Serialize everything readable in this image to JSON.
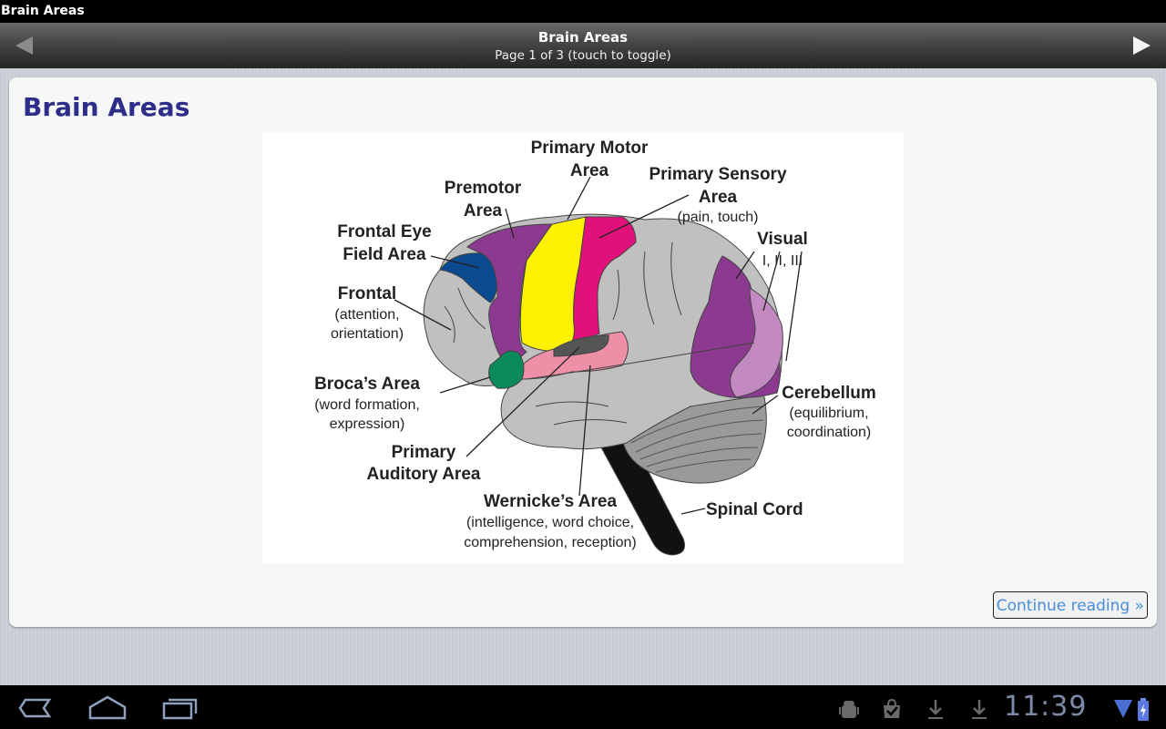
{
  "app": {
    "window_title": "Brain Areas"
  },
  "nav": {
    "title": "Brain Areas",
    "subtitle": "Page 1 of 3 (touch to toggle)",
    "prev_icon": "triangle-left-icon",
    "next_icon": "triangle-right-icon"
  },
  "page": {
    "heading": "Brain Areas",
    "continue_label": "Continue reading »"
  },
  "figure": {
    "labels": {
      "primary_motor_1": "Primary Motor",
      "primary_motor_2": "Area",
      "primary_sensory_1": "Primary Sensory",
      "primary_sensory_2": "Area",
      "primary_sensory_3": "(pain, touch)",
      "premotor_1": "Premotor",
      "premotor_2": "Area",
      "frontal_eye_1": "Frontal Eye",
      "frontal_eye_2": "Field Area",
      "visual_1": "Visual",
      "visual_2": "I, II, III",
      "frontal_1": "Frontal",
      "frontal_2": "(attention,",
      "frontal_3": "orientation)",
      "broca_1": "Broca’s Area",
      "broca_2": "(word formation,",
      "broca_3": "expression)",
      "cerebellum_1": "Cerebellum",
      "cerebellum_2": "(equilibrium,",
      "cerebellum_3": "coordination)",
      "auditory_1": "Primary",
      "auditory_2": "Auditory Area",
      "wernicke_1": "Wernicke’s Area",
      "wernicke_2": "(intelligence, word choice,",
      "wernicke_3": "comprehension, reception)",
      "spinal_1": "Spinal Cord"
    },
    "colors": {
      "cortex": "#c0c0c0",
      "premotor": "#8b3a8f",
      "primary_motor": "#fff200",
      "primary_sensory": "#e0117a",
      "frontal_eye": "#0b4a8f",
      "broca": "#0a8a5a",
      "auditory": "#555555",
      "wernicke": "#ee8fa8",
      "visual_1": "#8b3a8f",
      "visual_2": "#c28ac0",
      "cerebellum": "#9a9a9a",
      "spinal_cord": "#111111"
    }
  },
  "system_bar": {
    "back_icon": "back-icon",
    "home_icon": "home-icon",
    "recents_icon": "recent-apps-icon",
    "notifications": [
      "android-debug-icon",
      "market-check-icon",
      "download-icon",
      "download-icon"
    ],
    "time": "11:39",
    "wifi_icon": "wifi-icon",
    "battery_icon": "battery-charging-icon"
  }
}
